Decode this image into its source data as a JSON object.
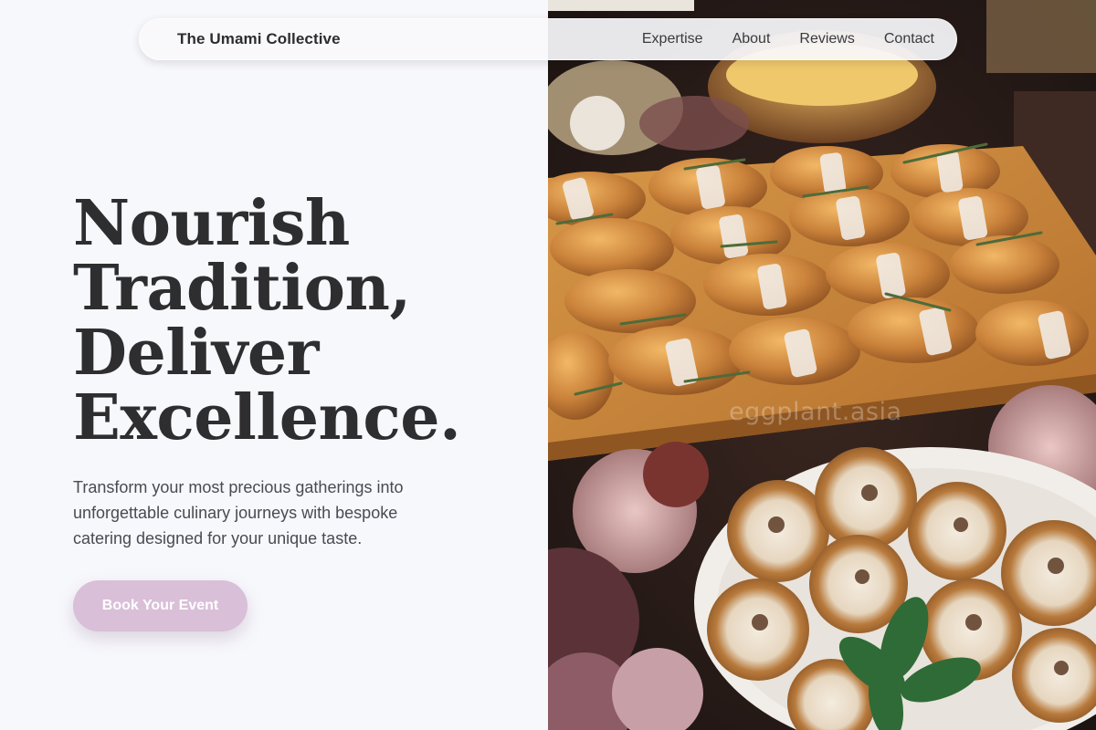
{
  "brand": {
    "name": "The Umami Collective"
  },
  "nav": {
    "links": [
      "Expertise",
      "About",
      "Reviews",
      "Contact"
    ]
  },
  "hero": {
    "headline_lines": [
      "Nourish",
      "Tradition,",
      "Deliver",
      "Excellence."
    ],
    "description": "Transform your most precious gatherings into unforgettable culinary journeys with bespoke catering designed for your unique taste.",
    "cta_label": "Book Your Event"
  },
  "photo": {
    "watermark": "eggplant.asia"
  },
  "colors": {
    "background": "#f7f8fc",
    "text": "#2e2e30",
    "cta": "#d9bfd8"
  }
}
